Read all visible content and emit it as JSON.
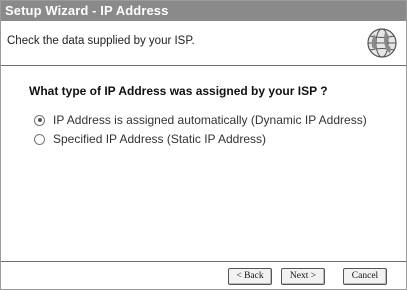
{
  "window": {
    "title": "Setup Wizard - IP Address"
  },
  "info": {
    "text": "Check the data supplied by your ISP.",
    "icon": "globe-icon"
  },
  "question": "What type of IP Address was assigned by your ISP ?",
  "options": [
    {
      "label": "IP Address is assigned automatically (Dynamic IP Address)",
      "selected": true
    },
    {
      "label": "Specified IP Address (Static IP Address)",
      "selected": false
    }
  ],
  "buttons": {
    "back": "< Back",
    "next": "Next >",
    "cancel": "Cancel"
  }
}
